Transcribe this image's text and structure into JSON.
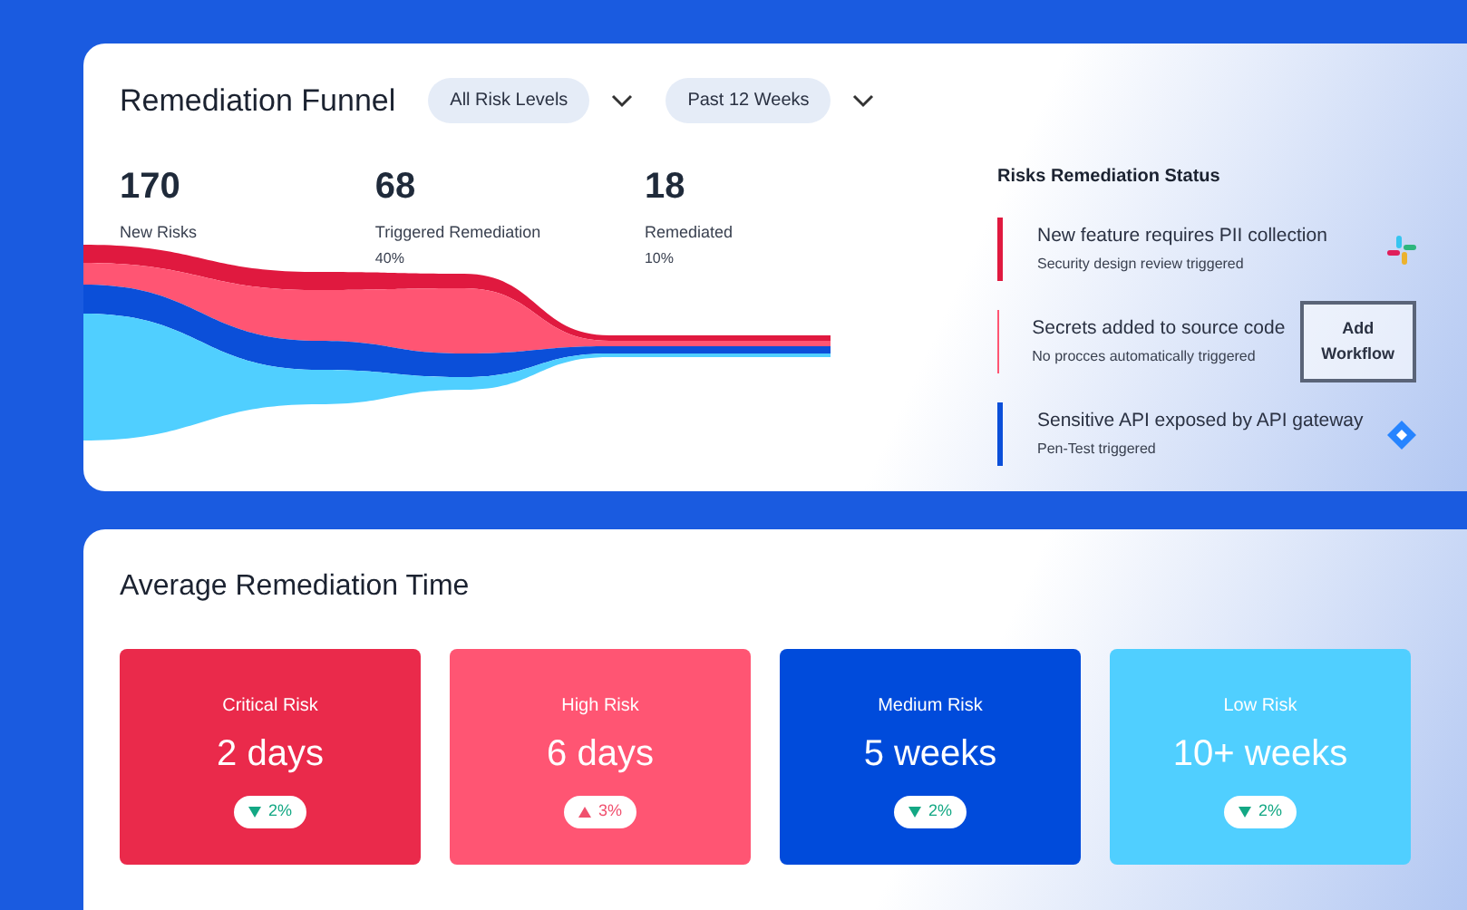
{
  "funnel": {
    "title": "Remediation Funnel",
    "filters": [
      {
        "label": "All Risk Levels"
      },
      {
        "label": "Past 12 Weeks"
      }
    ],
    "stats": [
      {
        "value": "170",
        "label": "New Risks"
      },
      {
        "value": "68",
        "label": "Triggered Remediation",
        "percent": "40%"
      },
      {
        "value": "18",
        "label": "Remediated",
        "percent": "10%"
      }
    ]
  },
  "status": {
    "title": "Risks Remediation Status",
    "items": [
      {
        "title": "New feature requires PII collection",
        "subtitle": "Security design review triggered",
        "color": "#e0193f",
        "kind": "grid-icon"
      },
      {
        "title": "Secrets added to source code",
        "subtitle": "No procces automatically triggered",
        "color": "#ff5573",
        "kind": "button",
        "action": "Add Workflow"
      },
      {
        "title": "Sensitive API exposed by API gateway",
        "subtitle": "Pen-Test triggered",
        "color": "#0b4fd9",
        "kind": "diamond-icon"
      }
    ]
  },
  "average": {
    "title": "Average Remediation Time",
    "cards": [
      {
        "label": "Critical Risk",
        "value": "2 days",
        "change": "2%",
        "rising": false,
        "color": "#ea2a4b"
      },
      {
        "label": "High Risk",
        "value": "6 days",
        "change": "3%",
        "rising": true,
        "color": "#ff5573"
      },
      {
        "label": "Medium Risk",
        "value": "5 weeks",
        "change": "2%",
        "rising": false,
        "color": "#004bdb"
      },
      {
        "label": "Low Risk",
        "value": "10+ weeks",
        "change": "2%",
        "rising": false,
        "color": "#50cfff"
      }
    ]
  }
}
